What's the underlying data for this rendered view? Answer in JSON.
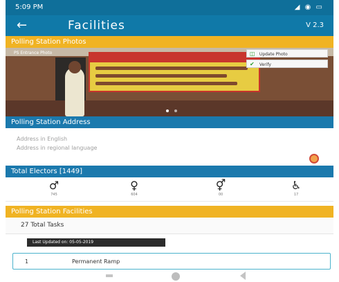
{
  "status_bar": {
    "time": "5:09 PM",
    "indicators": "signal wifi battery"
  },
  "app_bar": {
    "title": "Facilities",
    "version": "V 2.3",
    "back_icon": "back-arrow-icon"
  },
  "photos_section": {
    "title": "Polling Station Photos",
    "photo_caption": "PS Entrance Photo",
    "actions": [
      {
        "label": "Update Photo",
        "icon": "camera-icon"
      },
      {
        "label": "Verify",
        "icon": "check-icon"
      }
    ],
    "pagination_dots": 2
  },
  "address_section": {
    "title": "Polling Station Address",
    "line_english": "Address in English",
    "line_regional": "Address in regional language",
    "pin_icon": "map-pin-icon"
  },
  "electors_section": {
    "title": "Total Electors [1449]",
    "items": [
      {
        "icon": "male-icon",
        "count": "745"
      },
      {
        "icon": "female-icon",
        "count": "604"
      },
      {
        "icon": "third-gender-icon",
        "count": "00"
      },
      {
        "icon": "wheelchair-icon",
        "count": "17"
      }
    ]
  },
  "facilities_section": {
    "title": "Polling Station Facilities",
    "total_tasks": "27 Total Tasks",
    "last_updated": "Last Updated on: 05-05-2019",
    "first_task": {
      "number": "1",
      "name": "Permanent Ramp"
    }
  },
  "colors": {
    "primary": "#1079a8",
    "accent_yellow": "#f0b323",
    "badge_dark": "#2c2c2c",
    "task_border": "#4bb2cc"
  }
}
